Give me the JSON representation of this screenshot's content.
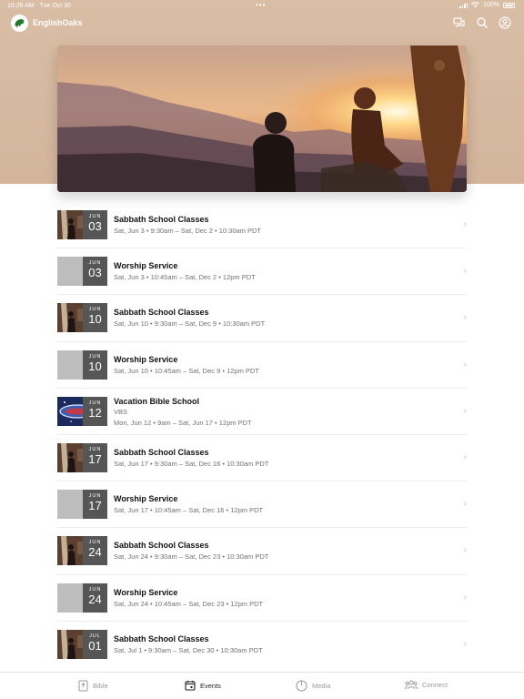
{
  "status_bar": {
    "time": "10:26 AM",
    "date": "Tue Oct 30",
    "battery": "100%"
  },
  "app": {
    "name": "EnglishOaks"
  },
  "nav_icons": [
    "chat-icon",
    "search-icon",
    "profile-icon"
  ],
  "events": [
    {
      "title": "Sabbath School Classes",
      "detail": "",
      "time": "Sat, Jun 3 • 9:30am – Sat, Dec 2 • 10:30am PDT",
      "month": "JUN",
      "day": "03",
      "thumb": "photo"
    },
    {
      "title": "Worship Service",
      "detail": "",
      "time": "Sat, Jun 3 • 10:45am – Sat, Dec 2 • 12pm PDT",
      "month": "JUN",
      "day": "03",
      "thumb": "gray"
    },
    {
      "title": "Sabbath School Classes",
      "detail": "",
      "time": "Sat, Jun 10 • 9:30am – Sat, Dec 9 • 10:30am PDT",
      "month": "JUN",
      "day": "10",
      "thumb": "photo"
    },
    {
      "title": "Worship Service",
      "detail": "",
      "time": "Sat, Jun 10 • 10:45am – Sat, Dec 9 • 12pm PDT",
      "month": "JUN",
      "day": "10",
      "thumb": "gray"
    },
    {
      "title": "Vacation Bible School",
      "detail": "VBS",
      "time": "Mon, Jun 12 • 9am – Sat, Jun 17 • 12pm PDT",
      "month": "JUN",
      "day": "12",
      "thumb": "vbs"
    },
    {
      "title": "Sabbath School Classes",
      "detail": "",
      "time": "Sat, Jun 17 • 9:30am – Sat, Dec 16 • 10:30am PDT",
      "month": "JUN",
      "day": "17",
      "thumb": "photo"
    },
    {
      "title": "Worship Service",
      "detail": "",
      "time": "Sat, Jun 17 • 10:45am – Sat, Dec 16 • 12pm PDT",
      "month": "JUN",
      "day": "17",
      "thumb": "gray"
    },
    {
      "title": "Sabbath School Classes",
      "detail": "",
      "time": "Sat, Jun 24 • 9:30am – Sat, Dec 23 • 10:30am PDT",
      "month": "JUN",
      "day": "24",
      "thumb": "photo"
    },
    {
      "title": "Worship Service",
      "detail": "",
      "time": "Sat, Jun 24 • 10:45am – Sat, Dec 23 • 12pm PDT",
      "month": "JUN",
      "day": "24",
      "thumb": "gray"
    },
    {
      "title": "Sabbath School Classes",
      "detail": "",
      "time": "Sat, Jul 1 • 9:30am – Sat, Dec 30 • 10:30am PDT",
      "month": "JUL",
      "day": "01",
      "thumb": "photo"
    }
  ],
  "tabs": [
    {
      "label": "Bible",
      "icon": "bible-icon",
      "active": false
    },
    {
      "label": "Events",
      "icon": "calendar-icon",
      "active": true
    },
    {
      "label": "Media",
      "icon": "media-icon",
      "active": false
    },
    {
      "label": "Connect",
      "icon": "connect-icon",
      "active": false
    }
  ]
}
